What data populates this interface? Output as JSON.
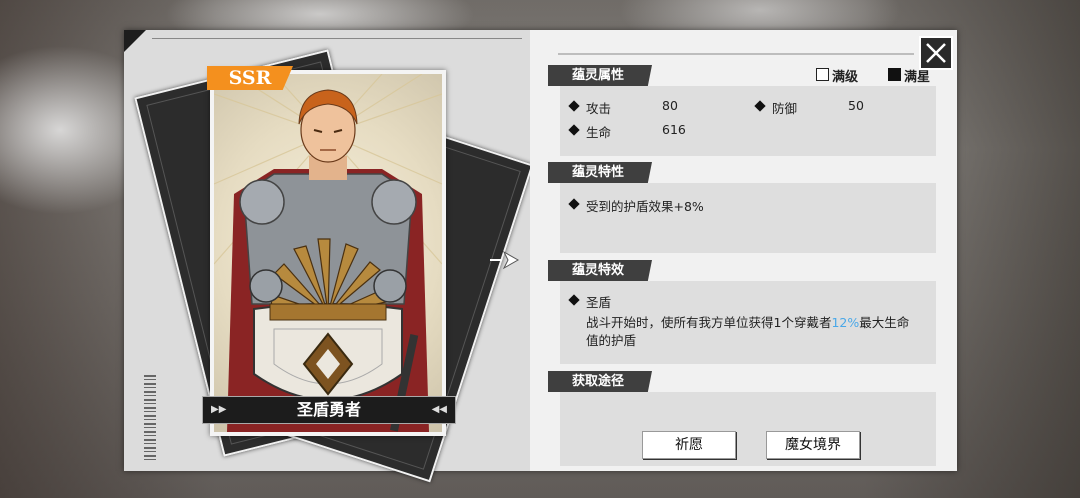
{
  "card": {
    "rarity": "SSR",
    "name": "圣盾勇者"
  },
  "toggles": {
    "max_level_label": "满级",
    "max_level_checked": false,
    "max_star_label": "满星",
    "max_star_checked": true
  },
  "attributes": {
    "title": "蕴灵属性",
    "stats": [
      {
        "label": "攻击",
        "value": "80"
      },
      {
        "label": "防御",
        "value": "50"
      },
      {
        "label": "生命",
        "value": "616"
      }
    ]
  },
  "traits": {
    "title": "蕴灵特性",
    "items": [
      "受到的护盾效果+8%"
    ]
  },
  "effects": {
    "title": "蕴灵特效",
    "name": "圣盾",
    "desc_before": "战斗开始时，使所有我方单位获得1个穿戴者",
    "desc_highlight": "12%",
    "desc_after": "最大生命",
    "desc_line2": "值的护盾",
    "highlight_color": "#4aa8e8"
  },
  "obtain": {
    "title": "获取途径",
    "sources": [
      "祈愿",
      "魔女境界"
    ]
  },
  "colors": {
    "rarity_badge": "#f4901e",
    "section_tag": "#3f3f3f"
  },
  "icons": {
    "close": "close-icon",
    "arrow": "right-arrow-icon",
    "bullet": "diamond-bullet-icon"
  }
}
